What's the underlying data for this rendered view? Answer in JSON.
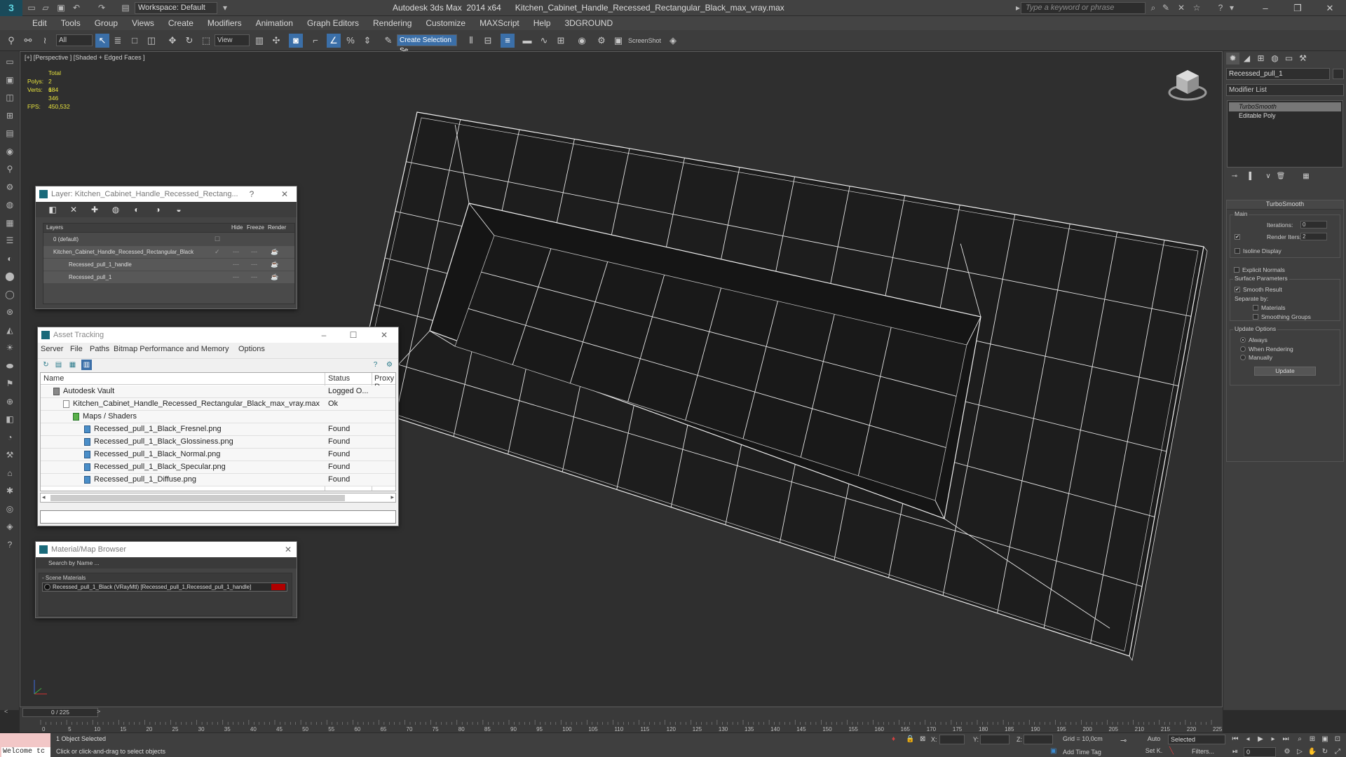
{
  "titlebar": {
    "workspace": "Workspace: Default",
    "app_title": "Autodesk 3ds Max  2014 x64",
    "file_title": "Kitchen_Cabinet_Handle_Recessed_Rectangular_Black_max_vray.max",
    "search_placeholder": "Type a keyword or phrase"
  },
  "menu": [
    "Edit",
    "Tools",
    "Group",
    "Views",
    "Create",
    "Modifiers",
    "Animation",
    "Graph Editors",
    "Rendering",
    "Customize",
    "MAXScript",
    "Help",
    "3DGROUND"
  ],
  "toolbar": {
    "filter_all": "All",
    "ref_coord": "View",
    "selection_set": "Create Selection Se",
    "screenshot_label": "ScreenShot"
  },
  "viewport": {
    "label": "[+] [Perspective ] [Shaded + Edged Faces ]",
    "stats": {
      "total_label": "Total",
      "polys_label": "Polys:",
      "polys": "2 684",
      "verts_label": "Verts:",
      "verts": "1 346",
      "fps_label": "FPS:",
      "fps": "450,532"
    }
  },
  "layer_dialog": {
    "title": "Layer: Kitchen_Cabinet_Handle_Recessed_Rectang...",
    "help": "?",
    "columns": {
      "layers": "Layers",
      "hide": "Hide",
      "freeze": "Freeze",
      "render": "Render"
    },
    "rows": [
      "0 (default)",
      "Kitchen_Cabinet_Handle_Recessed_Rectangular_Black",
      "Recessed_pull_1_handle",
      "Recessed_pull_1"
    ]
  },
  "asset_dialog": {
    "title": "Asset Tracking",
    "menu": [
      "Server",
      "File",
      "Paths",
      "Bitmap Performance and Memory",
      "Options"
    ],
    "columns": {
      "name": "Name",
      "status": "Status",
      "proxy": "Proxy R"
    },
    "rows": [
      {
        "name": "Autodesk Vault",
        "status": "Logged O..."
      },
      {
        "name": "Kitchen_Cabinet_Handle_Recessed_Rectangular_Black_max_vray.max",
        "status": "Ok"
      },
      {
        "name": "Maps / Shaders",
        "status": ""
      },
      {
        "name": "Recessed_pull_1_Black_Fresnel.png",
        "status": "Found"
      },
      {
        "name": "Recessed_pull_1_Black_Glossiness.png",
        "status": "Found"
      },
      {
        "name": "Recessed_pull_1_Black_Normal.png",
        "status": "Found"
      },
      {
        "name": "Recessed_pull_1_Black_Specular.png",
        "status": "Found"
      },
      {
        "name": "Recessed_pull_1_Diffuse.png",
        "status": "Found"
      }
    ]
  },
  "material_dialog": {
    "title": "Material/Map Browser",
    "search_placeholder": "Search by Name ...",
    "group": "- Scene Materials",
    "item": "Recessed_pull_1_Black  (VRayMtl)  [Recessed_pull_1,Recessed_pull_1_handle]",
    "swatch_color": "#b00000"
  },
  "command_panel": {
    "object_name": "Recessed_pull_1",
    "modifier_list": "Modifier List",
    "stack": [
      "TurboSmooth",
      "Editable Poly"
    ],
    "turbosmooth": {
      "title": "TurboSmooth",
      "main": "Main",
      "iterations_label": "Iterations:",
      "iterations": "0",
      "render_iters_label": "Render Iters:",
      "render_iters": "2",
      "isoline": "Isoline Display",
      "explicit_normals": "Explicit Normals",
      "surface_params": "Surface Parameters",
      "smooth_result": "Smooth Result",
      "separate_by": "Separate by:",
      "materials": "Materials",
      "smoothing_groups": "Smoothing Groups",
      "update_options": "Update Options",
      "always": "Always",
      "when_rendering": "When Rendering",
      "manually": "Manually",
      "update_btn": "Update"
    }
  },
  "timeline": {
    "slider": "0 / 225",
    "ticks": [
      "0",
      "5",
      "10",
      "15",
      "20",
      "25",
      "30",
      "35",
      "40",
      "45",
      "50",
      "55",
      "60",
      "65",
      "70",
      "75",
      "80",
      "85",
      "90",
      "95",
      "100",
      "105",
      "110",
      "115",
      "120",
      "125",
      "130",
      "135",
      "140",
      "145",
      "150",
      "155",
      "160",
      "165",
      "170",
      "175",
      "180",
      "185",
      "190",
      "195",
      "200",
      "205",
      "210",
      "215",
      "220",
      "225"
    ]
  },
  "status": {
    "listener": "Welcome tc",
    "selection": "1 Object Selected",
    "prompt": "Click or click-and-drag to select objects",
    "x_label": "X:",
    "y_label": "Y:",
    "z_label": "Z:",
    "grid": "Grid = 10,0cm",
    "add_time_tag": "Add Time Tag",
    "auto": "Auto",
    "selected": "Selected",
    "set_k": "Set K.",
    "filters": "Filters...",
    "frame": "0"
  }
}
